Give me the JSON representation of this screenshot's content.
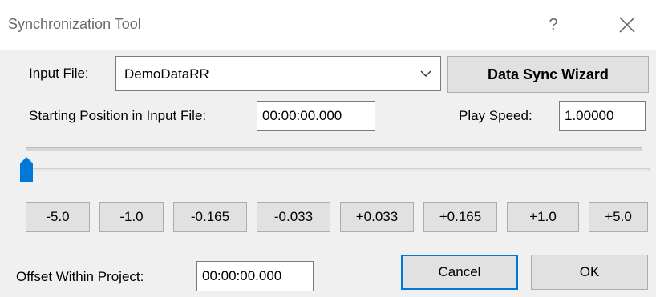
{
  "window": {
    "title": "Synchronization Tool",
    "help_glyph": "?",
    "close_icon": "close-icon"
  },
  "input_file": {
    "label": "Input File:",
    "value": "DemoDataRR"
  },
  "wizard_button": "Data Sync Wizard",
  "starting_position": {
    "label": "Starting Position in Input File:",
    "value": "00:00:00.000"
  },
  "play_speed": {
    "label": "Play Speed:",
    "value": "1.00000"
  },
  "slider": {
    "position_fraction": 0.0
  },
  "step_buttons": [
    "-5.0",
    "-1.0",
    "-0.165",
    "-0.033",
    "+0.033",
    "+0.165",
    "+1.0",
    "+5.0"
  ],
  "offset": {
    "label": "Offset Within Project:",
    "value": "00:00:00.000"
  },
  "footer": {
    "cancel": "Cancel",
    "ok": "OK"
  },
  "colors": {
    "accent": "#0078d7",
    "thumb": "#0078d7"
  }
}
